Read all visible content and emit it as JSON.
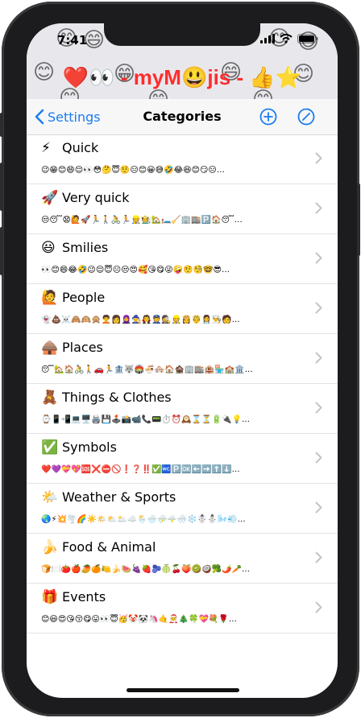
{
  "status": {
    "time": "7:41"
  },
  "banner": {
    "title_prefix": "❤️👀",
    "title_text": " - myM",
    "title_mid": "😃",
    "title_end": "jis - ",
    "title_suffix": "👍⭐"
  },
  "nav": {
    "back_label": "Settings",
    "title": "Categories"
  },
  "categories": [
    {
      "icon": "⚡",
      "label": "Quick",
      "preview": "😉😁😊😄😌👀😳🤔😇🤨😑😊😀😅🤣😂😆😊😏😑…"
    },
    {
      "icon": "🚀",
      "label": "Very quick",
      "preview": "😒😴😧🙋🚀🏃🚶🚴🏃👷🧑‍🌾🏡🛏️🧹🏢🏬🅿️🏠😴…"
    },
    {
      "icon": "😃",
      "label": "Smilies",
      "preview": "👀😊😄😂🤣😉😌😇😐😒😍🥰😘😋😜🤪🤨🧐🤓😎…"
    },
    {
      "icon": "🙋",
      "label": "People",
      "preview": "👻💩☠️🙈🙉🙊🧑‍🦱👩🧕🧙🧛👮🕵️👷👸🤴👩‍⚕️👨‍🍳🧑…"
    },
    {
      "icon": "🛖",
      "label": "Places",
      "preview": "😴🏡🏠🚴🚶🚗🏃🏦🐺🏟️🍜🏘️🏠🏚️🏢🏬🏨🏪🏫🏛️…"
    },
    {
      "icon": "🧸",
      "label": "Things & Clothes",
      "preview": "⌚📱📲💻🖥️🖨️💾🕹️📸📹📞📟⏱️⏰🕰️⌛⏳🔋🔌💡…"
    },
    {
      "icon": "✅",
      "label": "Symbols",
      "preview": "❤️💜💝💖🆘❌⛔🚫❗❓‼️✅🚾🅿️🆗⬅️➡️⬆️⬇️…"
    },
    {
      "icon": "🌤️",
      "label": "Weather & Sports",
      "preview": "🌏⚡💥🌪️🌈☀️🌤️⛅🌥️☁️🌦️🌧️⛈️🌩️🌨️❄️☃️⛄🌬️💨…"
    },
    {
      "icon": "🍌",
      "label": "Food & Animal",
      "preview": "🍞🍽️🍅🍎🥭🍊🍋🍌🍉🍇🍓🫐🍈🍒🍑🥝🥥🥦🌶️🥕…"
    },
    {
      "icon": "🎁",
      "label": "Events",
      "preview": "😊😃😍😘😚😋😛👀😇🥳🤡🐼🦄🤙🧑‍🎄🎄🍀💝💐🌹…"
    }
  ],
  "colors": {
    "accent": "#1a7cf0",
    "title_red": "#ff2d2d",
    "separator": "#e3e3e6",
    "chevron": "#c4c4c7"
  }
}
